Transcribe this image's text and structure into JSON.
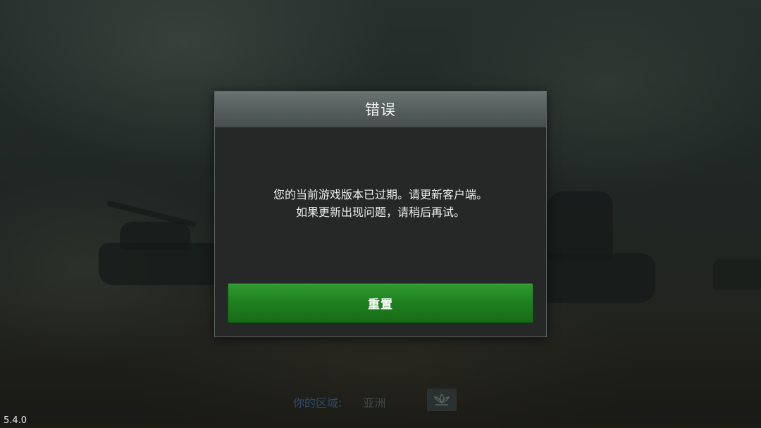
{
  "dialog": {
    "title": "错误",
    "message_lines": [
      "您的当前游戏版本已过期。请更新客户端。",
      "如果更新出现问题，请稍后再试。"
    ],
    "button_label": "重置"
  },
  "region": {
    "label": "你的区域:",
    "value": "亚洲",
    "icon": "lotus-emblem-icon"
  },
  "version": "5.4.0",
  "colors": {
    "button_green": "#218221",
    "header_gray": "#575e5e",
    "dialog_body": "#262827"
  }
}
